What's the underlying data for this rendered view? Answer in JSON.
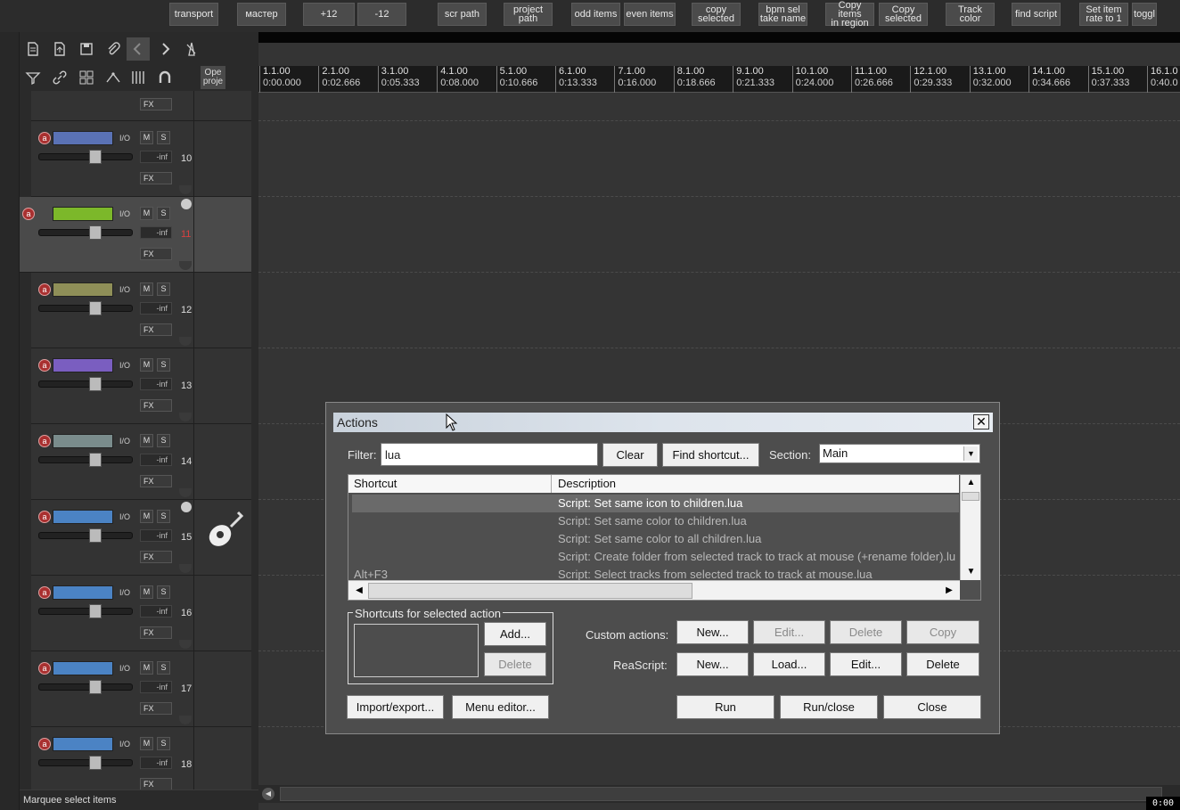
{
  "toolbar": {
    "buttons": [
      {
        "label": "transport"
      },
      {
        "label": "мастер"
      },
      {
        "label": "+12"
      },
      {
        "label": "-12"
      },
      {
        "label": "scr path"
      },
      {
        "label": "project\npath"
      },
      {
        "label": "odd items"
      },
      {
        "label": "even items"
      },
      {
        "label": "copy\nselected"
      },
      {
        "label": "bpm sel\ntake name"
      },
      {
        "label": "Copy items\nin region"
      },
      {
        "label": "Copy\nselected"
      },
      {
        "label": "Track\ncolor"
      },
      {
        "label": "find script"
      },
      {
        "label": "Set item\nrate to 1"
      },
      {
        "label": "toggl"
      }
    ]
  },
  "tcp_tools": {
    "open_project_label": "Ope\nproje"
  },
  "tracks": [
    {
      "number": "10",
      "color": "#5a72b5",
      "volume": "-inf",
      "selected": false
    },
    {
      "number": "11",
      "color": "#7cb82a",
      "volume": "-inf",
      "selected": true
    },
    {
      "number": "12",
      "color": "#8f8f58",
      "volume": "-inf",
      "selected": false
    },
    {
      "number": "13",
      "color": "#7a5ec0",
      "volume": "-inf",
      "selected": false
    },
    {
      "number": "14",
      "color": "#7a8c8c",
      "volume": "-inf",
      "selected": false
    },
    {
      "number": "15",
      "color": "#4b83c4",
      "volume": "-inf",
      "selected": false
    },
    {
      "number": "16",
      "color": "#4b83c4",
      "volume": "-inf",
      "selected": false
    },
    {
      "number": "17",
      "color": "#4b83c4",
      "volume": "-inf",
      "selected": false
    },
    {
      "number": "18",
      "color": "#4b83c4",
      "volume": "-inf",
      "selected": false
    }
  ],
  "track_controls": {
    "io": "I/O",
    "mute": "M",
    "solo": "S",
    "fx": "FX",
    "arm": "a"
  },
  "status_text": "Marquee select items",
  "ruler": [
    {
      "beat": "1.1.00",
      "time": "0:00.000"
    },
    {
      "beat": "2.1.00",
      "time": "0:02.666"
    },
    {
      "beat": "3.1.00",
      "time": "0:05.333"
    },
    {
      "beat": "4.1.00",
      "time": "0:08.000"
    },
    {
      "beat": "5.1.00",
      "time": "0:10.666"
    },
    {
      "beat": "6.1.00",
      "time": "0:13.333"
    },
    {
      "beat": "7.1.00",
      "time": "0:16.000"
    },
    {
      "beat": "8.1.00",
      "time": "0:18.666"
    },
    {
      "beat": "9.1.00",
      "time": "0:21.333"
    },
    {
      "beat": "10.1.00",
      "time": "0:24.000"
    },
    {
      "beat": "11.1.00",
      "time": "0:26.666"
    },
    {
      "beat": "12.1.00",
      "time": "0:29.333"
    },
    {
      "beat": "13.1.00",
      "time": "0:32.000"
    },
    {
      "beat": "14.1.00",
      "time": "0:34.666"
    },
    {
      "beat": "15.1.00",
      "time": "0:37.333"
    },
    {
      "beat": "16.1.0",
      "time": "0:40.0"
    }
  ],
  "clock": "0:00",
  "actions_dialog": {
    "title": "Actions",
    "close_glyph": "✕",
    "filter_label": "Filter:",
    "filter_value": "lua",
    "clear_label": "Clear",
    "find_shortcut_label": "Find shortcut...",
    "section_label": "Section:",
    "section_value": "Main",
    "columns": {
      "shortcut": "Shortcut",
      "description": "Description"
    },
    "rows": [
      {
        "shortcut": "",
        "description": "Script: Set same icon to children.lua",
        "selected": true
      },
      {
        "shortcut": "",
        "description": "Script: Set same color to children.lua",
        "selected": false
      },
      {
        "shortcut": "",
        "description": "Script: Set same color to all children.lua",
        "selected": false
      },
      {
        "shortcut": "",
        "description": "Script: Create folder from selected track to track at mouse (+rename folder).lu",
        "selected": false
      },
      {
        "shortcut": "Alt+F3",
        "description": "Script: Select tracks from selected track to track at mouse.lua",
        "selected": false
      }
    ],
    "shortcuts_group_title": "Shortcuts for selected action",
    "add_label": "Add...",
    "delete_shortcut_label": "Delete",
    "custom_actions_label": "Custom actions:",
    "custom_new": "New...",
    "custom_edit": "Edit...",
    "custom_delete": "Delete",
    "custom_copy": "Copy",
    "reascript_label": "ReaScript:",
    "rs_new": "New...",
    "rs_load": "Load...",
    "rs_edit": "Edit...",
    "rs_delete": "Delete",
    "import_export_label": "Import/export...",
    "menu_editor_label": "Menu editor...",
    "run_label": "Run",
    "run_close_label": "Run/close",
    "close_label": "Close"
  }
}
